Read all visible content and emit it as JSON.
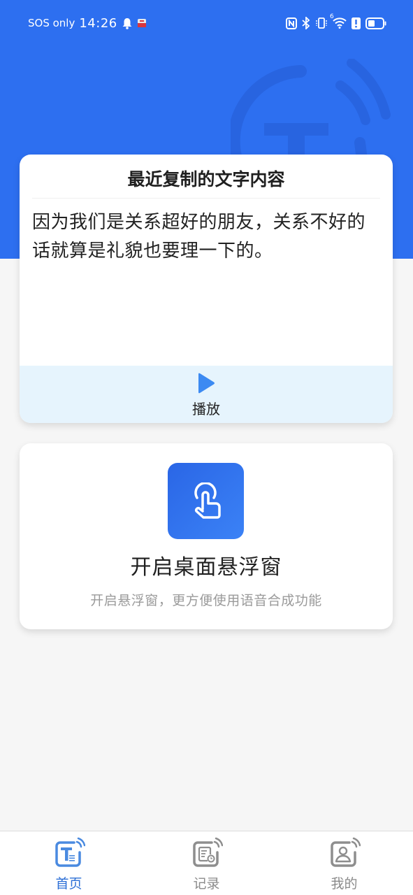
{
  "status_bar": {
    "carrier": "SOS only",
    "time": "14:26",
    "left_icons": [
      "bell-icon",
      "app-notification-icon"
    ],
    "right_icons": [
      "nfc-icon",
      "bluetooth-icon",
      "vibrate-icon",
      "wifi-icon",
      "alert-icon",
      "battery-icon"
    ],
    "wifi_badge": "6"
  },
  "colors": {
    "primary": "#2d6ff0",
    "accent": "#3b82f6",
    "play_bg": "#e6f4fd",
    "nav_active": "#2d6fd6",
    "nav_inactive": "#8a8a8a"
  },
  "clipboard_card": {
    "title": "最近复制的文字内容",
    "text": "因为我们是关系超好的朋友，关系不好的话就算是礼貌也要理一下的。",
    "play_label": "播放"
  },
  "float_card": {
    "title": "开启桌面悬浮窗",
    "subtitle": "开启悬浮窗，更方便使用语音合成功能"
  },
  "bottom_nav": {
    "items": [
      {
        "label": "首页",
        "icon": "text-to-speech-icon",
        "active": true
      },
      {
        "label": "记录",
        "icon": "history-record-icon",
        "active": false
      },
      {
        "label": "我的",
        "icon": "profile-icon",
        "active": false
      }
    ]
  }
}
